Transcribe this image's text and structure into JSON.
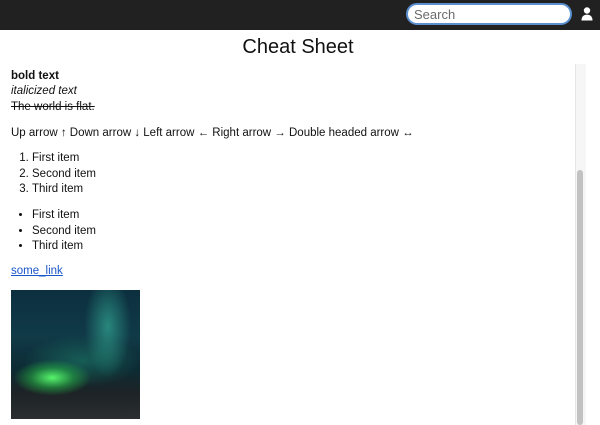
{
  "search": {
    "placeholder": "Search"
  },
  "page": {
    "title": "Cheat Sheet"
  },
  "content": {
    "bold_text": "bold text",
    "italic_text": "italicized text",
    "strike_text": "The world is flat.",
    "arrows_text": "Up arrow ↑ Down arrow ↓ Left arrow ← Right arrow → Double headed arrow ↔",
    "ordered_list": [
      "First item",
      "Second item",
      "Third item"
    ],
    "unordered_list": [
      "First item",
      "Second item",
      "Third item"
    ],
    "link_text": "some_link"
  },
  "colors": {
    "topbar": "#212121",
    "link": "#1a57c9",
    "search_border": "#5a8fd0"
  },
  "icons": {
    "user": "user-icon"
  }
}
